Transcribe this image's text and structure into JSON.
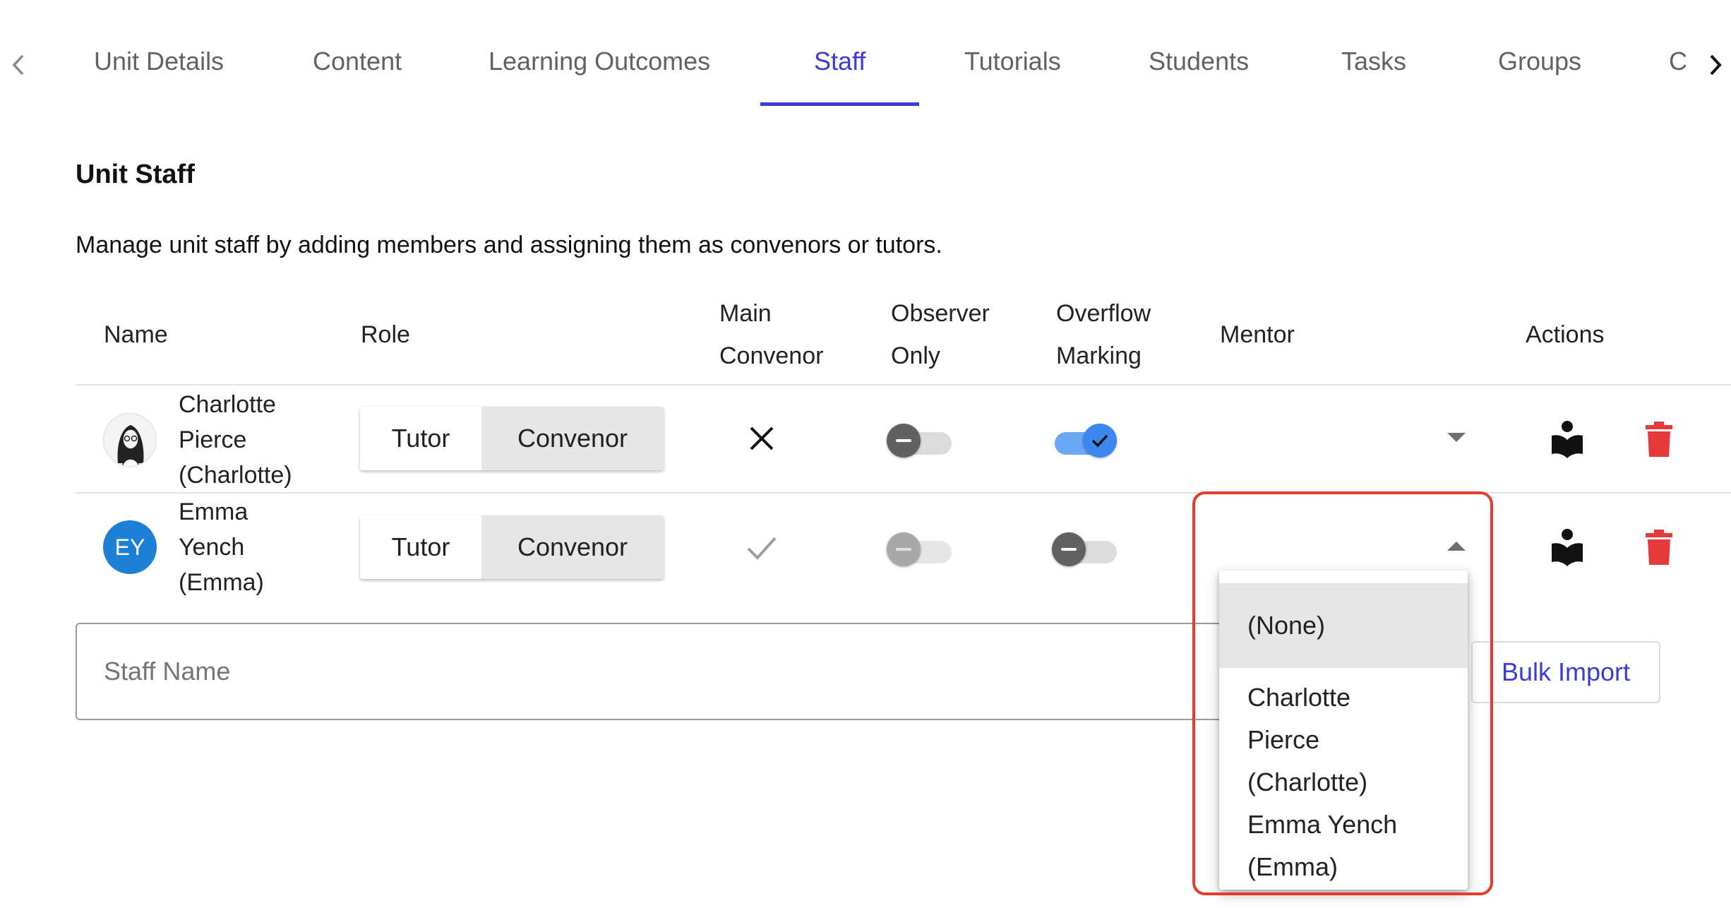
{
  "tabs": {
    "items": [
      {
        "label": "Unit Details"
      },
      {
        "label": "Content"
      },
      {
        "label": "Learning Outcomes"
      },
      {
        "label": "Staff"
      },
      {
        "label": "Tutorials"
      },
      {
        "label": "Students"
      },
      {
        "label": "Tasks"
      },
      {
        "label": "Groups"
      },
      {
        "label": "C"
      }
    ],
    "active": "Staff",
    "active_color": "#3b3bd6"
  },
  "section": {
    "title": "Unit Staff",
    "description": "Manage unit staff by adding members and assigning them as convenors or tutors."
  },
  "table": {
    "headers": {
      "name": "Name",
      "role": "Role",
      "main_convenor_1": "Main",
      "main_convenor_2": "Convenor",
      "observer_1": "Observer",
      "observer_2": "Only",
      "overflow_1": "Overflow",
      "overflow_2": "Marking",
      "mentor": "Mentor",
      "actions": "Actions"
    },
    "rows": [
      {
        "name_line1": "Charlotte",
        "name_line2": "Pierce",
        "name_line3": "(Charlotte)",
        "avatar": "portrait-photo",
        "role_tutor": "Tutor",
        "role_convenor": "Convenor",
        "main_convenor": "close-icon",
        "observer_only": false,
        "overflow_marking": true,
        "mentor": ""
      },
      {
        "name_line1": "Emma",
        "name_line2": "Yench",
        "name_line3": "(Emma)",
        "avatar_initials": "EY",
        "role_tutor": "Tutor",
        "role_convenor": "Convenor",
        "main_convenor": "check-icon",
        "observer_only": false,
        "overflow_marking": false,
        "mentor": ""
      }
    ]
  },
  "add_staff": {
    "placeholder": "Staff Name",
    "bulk_import_label": "Bulk Import"
  },
  "mentor_dropdown": {
    "options": [
      {
        "line1": "(None)"
      },
      {
        "line1": "Charlotte",
        "line2": "Pierce",
        "line3": "(Charlotte)"
      },
      {
        "line1": "Emma Yench",
        "line2": "(Emma)"
      }
    ],
    "selected": "(None)"
  },
  "colors": {
    "accent": "#3b3bd6",
    "delete": "#e53a3a",
    "toggle_on": "#6aa8f5",
    "highlight": "#e53a2c",
    "avatar_bg": "#1e7fd6"
  }
}
